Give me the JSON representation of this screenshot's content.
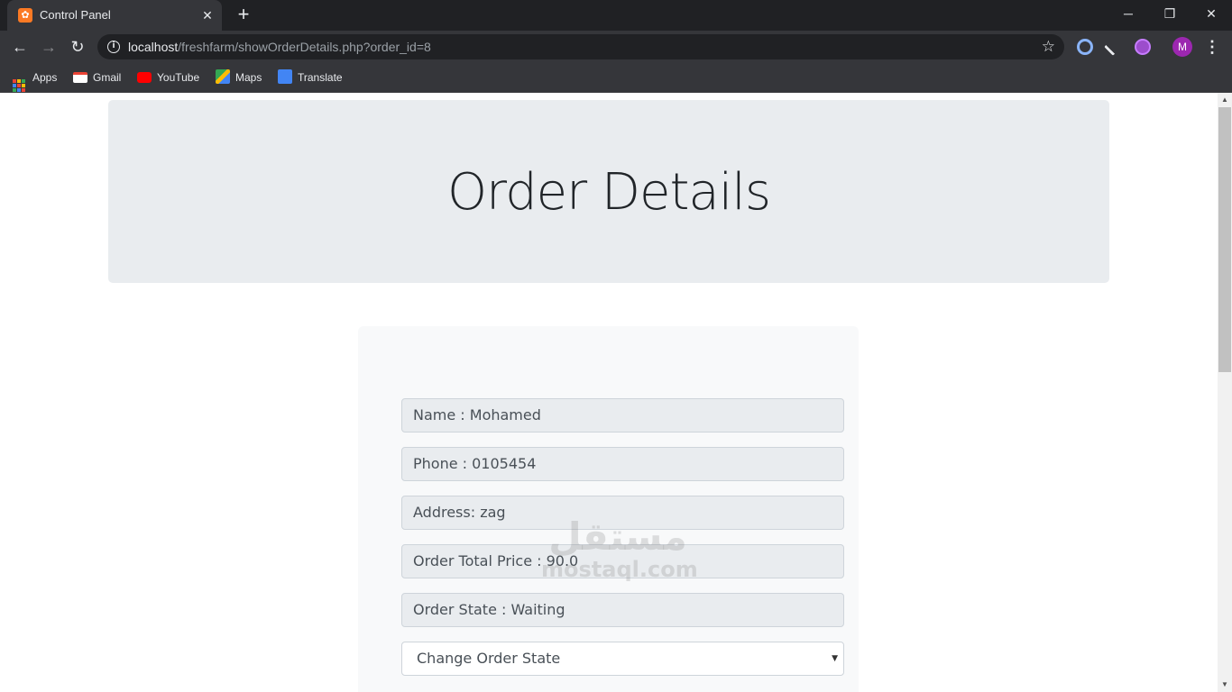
{
  "browser": {
    "tab": {
      "title": "Control Panel",
      "favicon": "xampp-icon"
    },
    "window_controls": {
      "minimize": "─",
      "restore": "❐",
      "close": "✕"
    },
    "url": {
      "host": "localhost",
      "path": "/freshfarm/showOrderDetails.php?order_id=8"
    },
    "profile_initial": "M",
    "bookmarks": [
      {
        "label": "Apps",
        "icon": "apps-grid-icon"
      },
      {
        "label": "Gmail",
        "icon": "gmail-icon"
      },
      {
        "label": "YouTube",
        "icon": "youtube-icon"
      },
      {
        "label": "Maps",
        "icon": "maps-icon"
      },
      {
        "label": "Translate",
        "icon": "translate-icon"
      }
    ]
  },
  "page": {
    "title": "Order Details",
    "fields": [
      {
        "value": "Name : Mohamed"
      },
      {
        "value": "Phone : 0105454"
      },
      {
        "value": "Address: zag"
      },
      {
        "value": "Order Total Price : 90.0"
      },
      {
        "value": "Order State : Waiting"
      }
    ],
    "state_select": {
      "selected": "Change Order State"
    }
  },
  "watermark": {
    "arabic": "مستقل",
    "latin": "mostaql.com"
  },
  "colors": {
    "jumbotron": "#e9ecef",
    "card": "#f8f9fa",
    "field_bg": "#e9ecef",
    "chrome_dark": "#202124",
    "chrome_toolbar": "#35363a"
  }
}
